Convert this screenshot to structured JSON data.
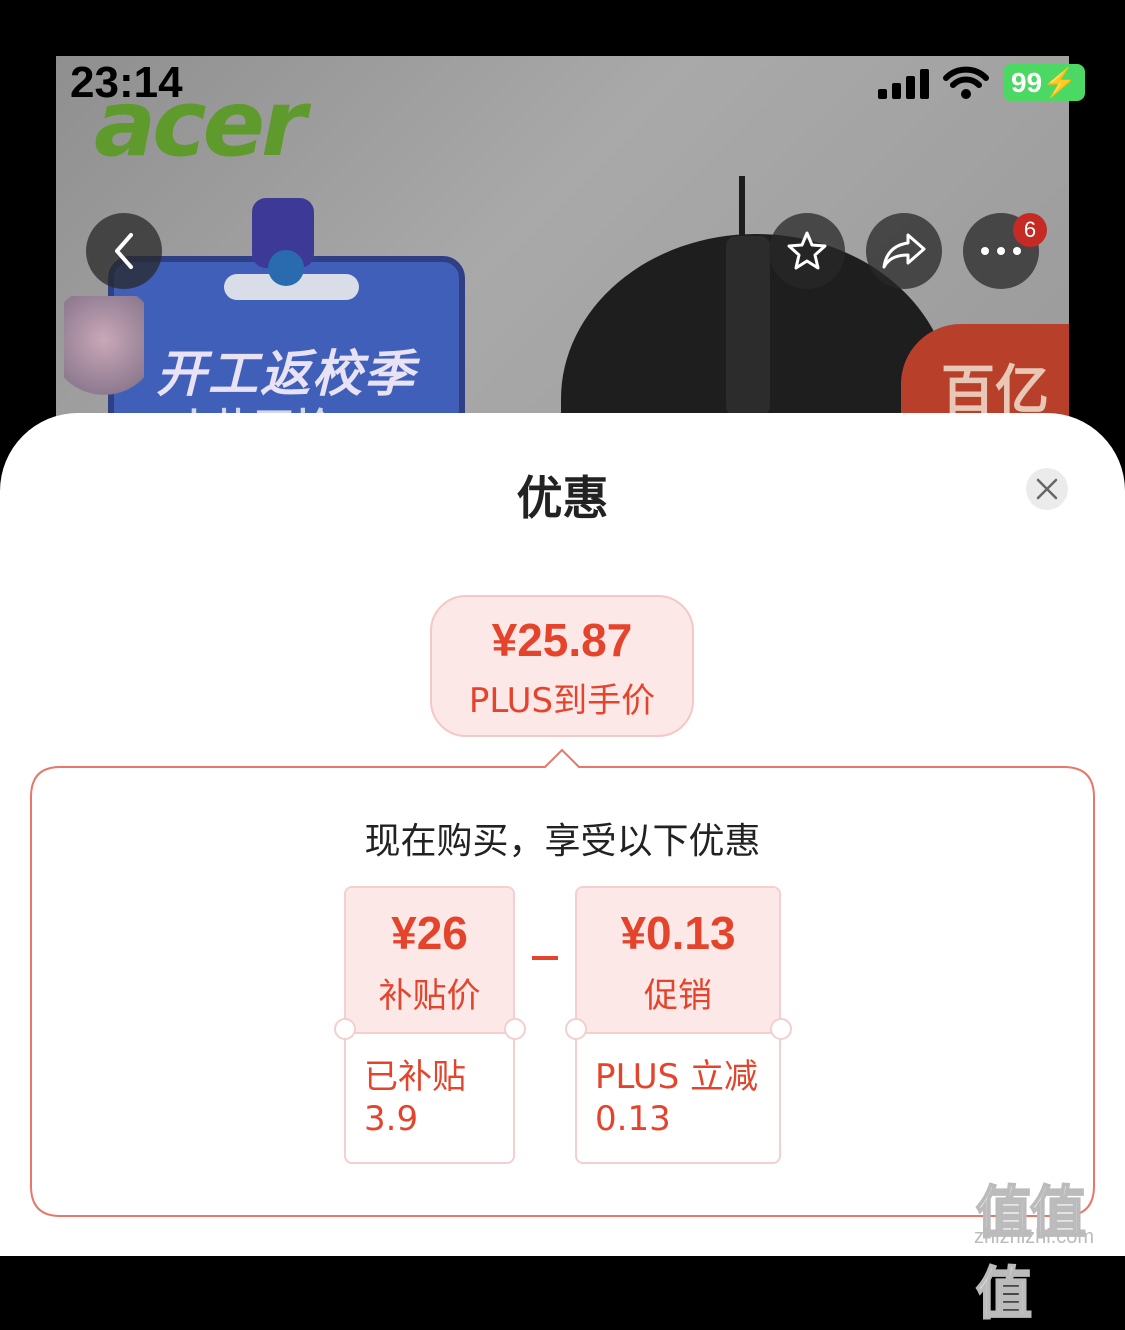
{
  "status_bar": {
    "time": "23:14",
    "battery": "99"
  },
  "product_banner": {
    "brand_logo": "acer",
    "promo_title": "开工返校季",
    "promo_subtitle": "火热开抢",
    "badge_text": "百亿补贴",
    "badge_visible_text": "百亿"
  },
  "nav": {
    "back_icon": "chevron-left-icon",
    "favorite_icon": "star-icon",
    "share_icon": "share-icon",
    "more_icon": "more-icon",
    "notification_count": "6"
  },
  "sheet": {
    "title": "优惠",
    "close_icon": "close-icon"
  },
  "final_price": {
    "amount": "¥25.87",
    "label": "PLUS到手价"
  },
  "discount_panel": {
    "heading": "现在购买，享受以下优惠",
    "operator": "-",
    "tickets": [
      {
        "amount": "¥26",
        "name": "补贴价",
        "detail_line1": "已补贴",
        "detail_line2": "3.9"
      },
      {
        "amount": "¥0.13",
        "name": "促销",
        "detail_line1": "PLUS 立减",
        "detail_line2": "0.13"
      }
    ]
  },
  "watermark": {
    "main": "值值值",
    "site": "zhizhizhi.com"
  },
  "colors": {
    "accent": "#e5442c",
    "ticket_bg": "#fde8e8",
    "border": "#f3cfcf"
  }
}
